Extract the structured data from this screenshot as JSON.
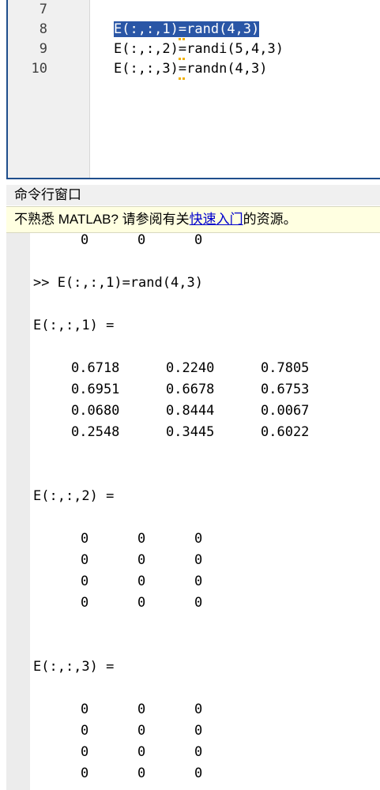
{
  "editor": {
    "line_numbers": [
      "7",
      "8",
      "9",
      "10"
    ],
    "lines": [
      {
        "lhs": "E(:,:,1)",
        "eq": "=",
        "rhs": "rand(4,3)"
      },
      {
        "lhs": "E(:,:,2)",
        "eq": "=",
        "rhs": "randi(5,4,3)"
      },
      {
        "lhs": "E(:,:,3)",
        "eq": "=",
        "rhs": "randn(4,3)"
      }
    ]
  },
  "command_window": {
    "title": "命令行窗口",
    "banner_prefix": "不熟悉 MATLAB? 请参阅有关",
    "banner_link": "快速入门",
    "banner_suffix": "的资源。",
    "top_row": [
      "0",
      "0",
      "0"
    ],
    "command": ">> E(:,:,1)=rand(4,3)",
    "block1_label": "E(:,:,1) =",
    "block1": [
      [
        "0.6718",
        "0.2240",
        "0.7805"
      ],
      [
        "0.6951",
        "0.6678",
        "0.6753"
      ],
      [
        "0.0680",
        "0.8444",
        "0.0067"
      ],
      [
        "0.2548",
        "0.3445",
        "0.6022"
      ]
    ],
    "block2_label": "E(:,:,2) =",
    "block2": [
      [
        "0",
        "0",
        "0"
      ],
      [
        "0",
        "0",
        "0"
      ],
      [
        "0",
        "0",
        "0"
      ],
      [
        "0",
        "0",
        "0"
      ]
    ],
    "block3_label": "E(:,:,3) =",
    "block3": [
      [
        "0",
        "0",
        "0"
      ],
      [
        "0",
        "0",
        "0"
      ],
      [
        "0",
        "0",
        "0"
      ],
      [
        "0",
        "0",
        "0"
      ]
    ]
  }
}
